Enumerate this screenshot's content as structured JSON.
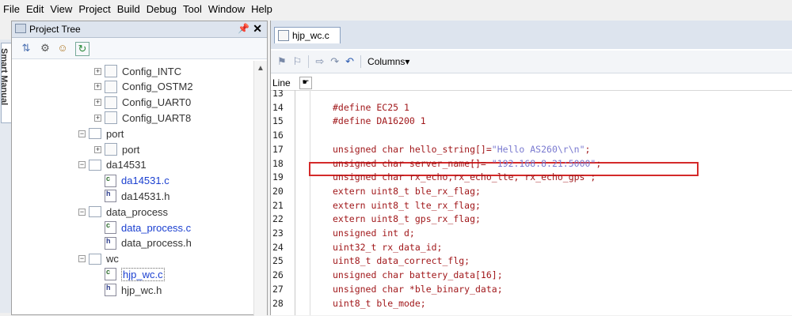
{
  "menubar": {
    "items": [
      "File",
      "Edit",
      "View",
      "Project",
      "Build",
      "Debug",
      "Tool",
      "Window",
      "Help"
    ]
  },
  "side_tab": {
    "label": "Smart Manual"
  },
  "project_tree": {
    "title": "Project Tree",
    "pin": "❕",
    "close": "✖",
    "nodes": [
      {
        "label": "Config_INTC",
        "type": "config",
        "expander": "+"
      },
      {
        "label": "Config_OSTM2",
        "type": "config",
        "expander": "+"
      },
      {
        "label": "Config_UART0",
        "type": "config",
        "expander": "+"
      },
      {
        "label": "Config_UART8",
        "type": "config",
        "expander": "+"
      },
      {
        "label": "port",
        "type": "folder",
        "expander": "−"
      },
      {
        "label": "port",
        "type": "config",
        "expander": "+"
      },
      {
        "label": "da14531",
        "type": "folder",
        "expander": "−"
      },
      {
        "label": "da14531.c",
        "type": "cfile",
        "color": "blue"
      },
      {
        "label": "da14531.h",
        "type": "hfile"
      },
      {
        "label": "data_process",
        "type": "folder",
        "expander": "−"
      },
      {
        "label": "data_process.c",
        "type": "cfile",
        "color": "blue"
      },
      {
        "label": "data_process.h",
        "type": "hfile"
      },
      {
        "label": "wc",
        "type": "folder",
        "expander": "−"
      },
      {
        "label": "hjp_wc.c",
        "type": "cfile",
        "color": "blue",
        "selected": true
      },
      {
        "label": "hjp_wc.h",
        "type": "hfile"
      }
    ]
  },
  "editor": {
    "tab_label": "hjp_wc.c",
    "columns_label": "Columns",
    "line_header": "Line",
    "highlight_color": "#d42a2a",
    "lines": [
      {
        "num": "13",
        "text": ""
      },
      {
        "num": "14",
        "text": "#define EC25 1"
      },
      {
        "num": "15",
        "text": "#define DA16200 1"
      },
      {
        "num": "16",
        "text": ""
      },
      {
        "num": "17",
        "text": "unsigned char hello_string[]=",
        "str": "\"Hello AS260\\r\\n\"",
        "tail": ";"
      },
      {
        "num": "18",
        "text": "unsigned char server_name[]= ",
        "str": "\"192.168.8.21:5000\"",
        "tail": ";"
      },
      {
        "num": "19",
        "text": "unsigned char rx_echo,rx_echo_lte, rx_echo_gps ;"
      },
      {
        "num": "20",
        "text": "extern uint8_t ble_rx_flag;"
      },
      {
        "num": "21",
        "text": "extern uint8_t lte_rx_flag;"
      },
      {
        "num": "22",
        "text": "extern uint8_t gps_rx_flag;"
      },
      {
        "num": "23",
        "text": "unsigned int d;"
      },
      {
        "num": "24",
        "text": "uint32_t rx_data_id;"
      },
      {
        "num": "25",
        "text": "uint8_t data_correct_flg;"
      },
      {
        "num": "26",
        "text": "unsigned char battery_data[16];"
      },
      {
        "num": "27",
        "text": "unsigned char *ble_binary_data;"
      },
      {
        "num": "28",
        "text": "uint8_t ble_mode;"
      }
    ]
  }
}
